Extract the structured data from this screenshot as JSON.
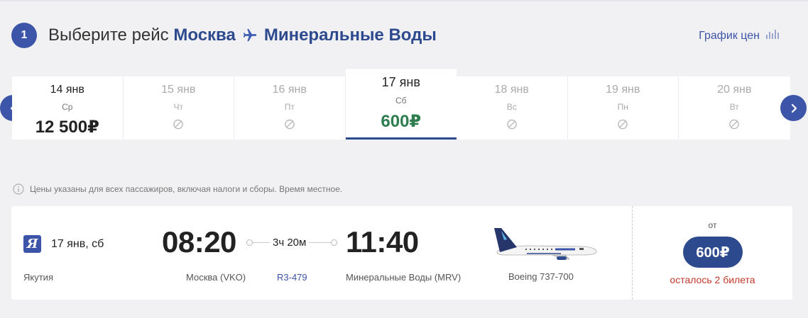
{
  "header": {
    "step": "1",
    "title_prefix": "Выберите рейс",
    "from_city": "Москва",
    "to_city": "Минеральные Воды",
    "price_chart_label": "График цен"
  },
  "dates": [
    {
      "date": "14 янв",
      "day": "Ср",
      "price": "12 500₽"
    },
    {
      "date": "15 янв",
      "day": "Чт"
    },
    {
      "date": "16 янв",
      "day": "Пт"
    },
    {
      "date": "17 янв",
      "day": "Сб",
      "price": "600₽",
      "active": true
    },
    {
      "date": "18 янв",
      "day": "Вс"
    },
    {
      "date": "19 янв",
      "day": "Пн"
    },
    {
      "date": "20 янв",
      "day": "Вт"
    }
  ],
  "note": "Цены указаны для всех пассажиров, включая налоги и сборы. Время местное.",
  "flight": {
    "airline_logo_letter": "Я",
    "date": "17 янв, сб",
    "airline": "Якутия",
    "departure_time": "08:20",
    "departure_airport": "Москва (VKO)",
    "duration": "3ч 20м",
    "flight_number": "R3-479",
    "arrival_time": "11:40",
    "arrival_airport": "Минеральные Воды (MRV)",
    "aircraft": "Boeing 737-700",
    "from_label": "от",
    "price": "600₽",
    "seats_left": "осталось 2 билета"
  },
  "colors": {
    "accent": "#3d55a8",
    "dark_accent": "#2e4a8f",
    "price_green": "#2e7d4f",
    "warning_red": "#c0392b"
  }
}
